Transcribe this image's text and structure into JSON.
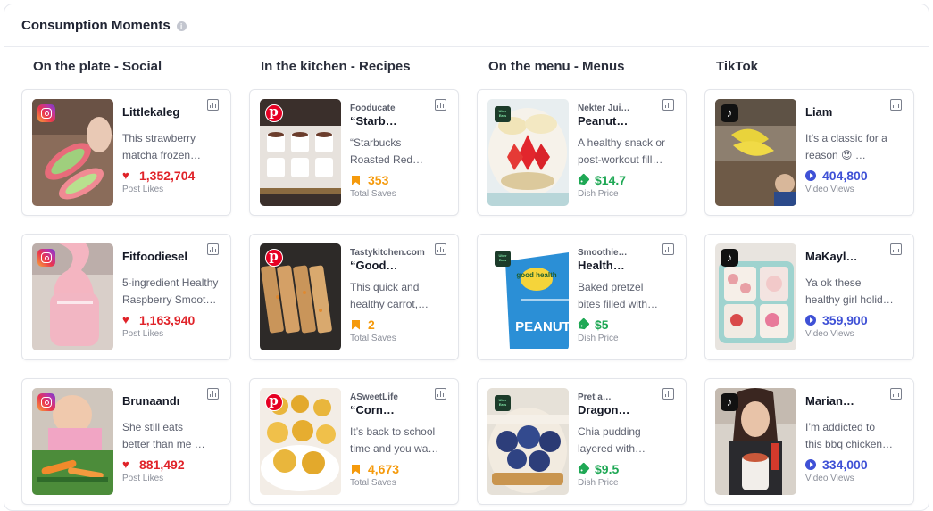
{
  "header": {
    "title": "Consumption Moments",
    "info_icon": "info-icon"
  },
  "colors": {
    "likes": "#e02329",
    "saves": "#f59a0c",
    "price": "#1fa855",
    "views": "#3f51d6"
  },
  "columns": [
    {
      "title": "On the plate - Social",
      "cards": [
        {
          "platform": "instagram",
          "title": "Littlekaleg",
          "desc": [
            "This strawberry",
            "matcha frozen…"
          ],
          "value": "1,352,704",
          "label": "Post Likes"
        },
        {
          "platform": "instagram",
          "title": "Fitfoodiesel",
          "desc": [
            "5-ingredient Healthy",
            "Raspberry Smoothie…"
          ],
          "value": "1,163,940",
          "label": "Post Likes"
        },
        {
          "platform": "instagram",
          "title": "Brunaandı",
          "desc": [
            "She still eats",
            "better than me …"
          ],
          "value": "881,492",
          "label": "Post Likes"
        }
      ]
    },
    {
      "title": "In the kitchen - Recipes",
      "cards": [
        {
          "platform": "pinterest",
          "source": "Fooducate",
          "title": "“Starb…",
          "desc": [
            "“Starbucks",
            "Roasted Red…"
          ],
          "value": "353",
          "label": "Total Saves"
        },
        {
          "platform": "pinterest",
          "source": "Tastykitchen.com",
          "title": "“Good…",
          "desc": [
            "This quick and",
            "healthy carrot,…"
          ],
          "value": "2",
          "label": "Total Saves"
        },
        {
          "platform": "pinterest",
          "source": "ASweetLife",
          "title": "“Corn…",
          "desc": [
            "It’s back to school",
            "time and you wa…"
          ],
          "value": "4,673",
          "label": "Total Saves"
        }
      ]
    },
    {
      "title": "On the menu - Menus",
      "cards": [
        {
          "platform": "ubereats",
          "source": "Nekter Jui…",
          "title": "Peanut…",
          "desc": [
            "A healthy snack or",
            "post-workout fill…"
          ],
          "value": "$14.7",
          "label": "Dish Price"
        },
        {
          "platform": "ubereats",
          "source": "Smoothie…",
          "title": "Health…",
          "desc": [
            "Baked pretzel",
            "bites filled with…"
          ],
          "value": "$5",
          "label": "Dish Price"
        },
        {
          "platform": "ubereats",
          "source": "Pret a…",
          "title": "Dragon…",
          "desc": [
            "Chia pudding",
            "layered with…"
          ],
          "value": "$9.5",
          "label": "Dish Price"
        }
      ]
    },
    {
      "title": "TikTok",
      "cards": [
        {
          "platform": "tiktok",
          "title": "Liam",
          "desc": [
            "It’s a classic for a",
            "reason 😍 …"
          ],
          "value": "404,800",
          "label": "Video Views"
        },
        {
          "platform": "tiktok",
          "title": "MaKayl…",
          "desc": [
            "Ya ok these",
            "healthy girl holid…"
          ],
          "value": "359,900",
          "label": "Video Views"
        },
        {
          "platform": "tiktok",
          "title": "Marian…",
          "desc": [
            "I’m addicted to",
            "this bbq chicken…"
          ],
          "value": "334,000",
          "label": "Video Views"
        }
      ]
    }
  ],
  "images": {
    "thumb_art": "thumbnails are decorative food photos",
    "misc": {
      "menus_thumb_2_text": "good health",
      "menus_thumb_2_caption": "PEANUT"
    }
  }
}
